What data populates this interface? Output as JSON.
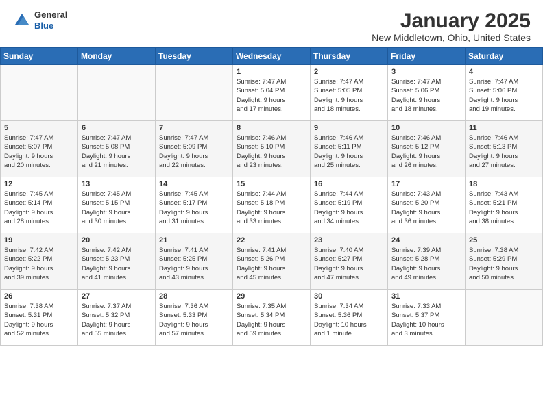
{
  "header": {
    "logo_line1": "General",
    "logo_line2": "Blue",
    "title": "January 2025",
    "subtitle": "New Middletown, Ohio, United States"
  },
  "days_of_week": [
    "Sunday",
    "Monday",
    "Tuesday",
    "Wednesday",
    "Thursday",
    "Friday",
    "Saturday"
  ],
  "weeks": [
    [
      {
        "day": "",
        "info": ""
      },
      {
        "day": "",
        "info": ""
      },
      {
        "day": "",
        "info": ""
      },
      {
        "day": "1",
        "info": "Sunrise: 7:47 AM\nSunset: 5:04 PM\nDaylight: 9 hours\nand 17 minutes."
      },
      {
        "day": "2",
        "info": "Sunrise: 7:47 AM\nSunset: 5:05 PM\nDaylight: 9 hours\nand 18 minutes."
      },
      {
        "day": "3",
        "info": "Sunrise: 7:47 AM\nSunset: 5:06 PM\nDaylight: 9 hours\nand 18 minutes."
      },
      {
        "day": "4",
        "info": "Sunrise: 7:47 AM\nSunset: 5:06 PM\nDaylight: 9 hours\nand 19 minutes."
      }
    ],
    [
      {
        "day": "5",
        "info": "Sunrise: 7:47 AM\nSunset: 5:07 PM\nDaylight: 9 hours\nand 20 minutes."
      },
      {
        "day": "6",
        "info": "Sunrise: 7:47 AM\nSunset: 5:08 PM\nDaylight: 9 hours\nand 21 minutes."
      },
      {
        "day": "7",
        "info": "Sunrise: 7:47 AM\nSunset: 5:09 PM\nDaylight: 9 hours\nand 22 minutes."
      },
      {
        "day": "8",
        "info": "Sunrise: 7:46 AM\nSunset: 5:10 PM\nDaylight: 9 hours\nand 23 minutes."
      },
      {
        "day": "9",
        "info": "Sunrise: 7:46 AM\nSunset: 5:11 PM\nDaylight: 9 hours\nand 25 minutes."
      },
      {
        "day": "10",
        "info": "Sunrise: 7:46 AM\nSunset: 5:12 PM\nDaylight: 9 hours\nand 26 minutes."
      },
      {
        "day": "11",
        "info": "Sunrise: 7:46 AM\nSunset: 5:13 PM\nDaylight: 9 hours\nand 27 minutes."
      }
    ],
    [
      {
        "day": "12",
        "info": "Sunrise: 7:45 AM\nSunset: 5:14 PM\nDaylight: 9 hours\nand 28 minutes."
      },
      {
        "day": "13",
        "info": "Sunrise: 7:45 AM\nSunset: 5:15 PM\nDaylight: 9 hours\nand 30 minutes."
      },
      {
        "day": "14",
        "info": "Sunrise: 7:45 AM\nSunset: 5:17 PM\nDaylight: 9 hours\nand 31 minutes."
      },
      {
        "day": "15",
        "info": "Sunrise: 7:44 AM\nSunset: 5:18 PM\nDaylight: 9 hours\nand 33 minutes."
      },
      {
        "day": "16",
        "info": "Sunrise: 7:44 AM\nSunset: 5:19 PM\nDaylight: 9 hours\nand 34 minutes."
      },
      {
        "day": "17",
        "info": "Sunrise: 7:43 AM\nSunset: 5:20 PM\nDaylight: 9 hours\nand 36 minutes."
      },
      {
        "day": "18",
        "info": "Sunrise: 7:43 AM\nSunset: 5:21 PM\nDaylight: 9 hours\nand 38 minutes."
      }
    ],
    [
      {
        "day": "19",
        "info": "Sunrise: 7:42 AM\nSunset: 5:22 PM\nDaylight: 9 hours\nand 39 minutes."
      },
      {
        "day": "20",
        "info": "Sunrise: 7:42 AM\nSunset: 5:23 PM\nDaylight: 9 hours\nand 41 minutes."
      },
      {
        "day": "21",
        "info": "Sunrise: 7:41 AM\nSunset: 5:25 PM\nDaylight: 9 hours\nand 43 minutes."
      },
      {
        "day": "22",
        "info": "Sunrise: 7:41 AM\nSunset: 5:26 PM\nDaylight: 9 hours\nand 45 minutes."
      },
      {
        "day": "23",
        "info": "Sunrise: 7:40 AM\nSunset: 5:27 PM\nDaylight: 9 hours\nand 47 minutes."
      },
      {
        "day": "24",
        "info": "Sunrise: 7:39 AM\nSunset: 5:28 PM\nDaylight: 9 hours\nand 49 minutes."
      },
      {
        "day": "25",
        "info": "Sunrise: 7:38 AM\nSunset: 5:29 PM\nDaylight: 9 hours\nand 50 minutes."
      }
    ],
    [
      {
        "day": "26",
        "info": "Sunrise: 7:38 AM\nSunset: 5:31 PM\nDaylight: 9 hours\nand 52 minutes."
      },
      {
        "day": "27",
        "info": "Sunrise: 7:37 AM\nSunset: 5:32 PM\nDaylight: 9 hours\nand 55 minutes."
      },
      {
        "day": "28",
        "info": "Sunrise: 7:36 AM\nSunset: 5:33 PM\nDaylight: 9 hours\nand 57 minutes."
      },
      {
        "day": "29",
        "info": "Sunrise: 7:35 AM\nSunset: 5:34 PM\nDaylight: 9 hours\nand 59 minutes."
      },
      {
        "day": "30",
        "info": "Sunrise: 7:34 AM\nSunset: 5:36 PM\nDaylight: 10 hours\nand 1 minute."
      },
      {
        "day": "31",
        "info": "Sunrise: 7:33 AM\nSunset: 5:37 PM\nDaylight: 10 hours\nand 3 minutes."
      },
      {
        "day": "",
        "info": ""
      }
    ]
  ]
}
